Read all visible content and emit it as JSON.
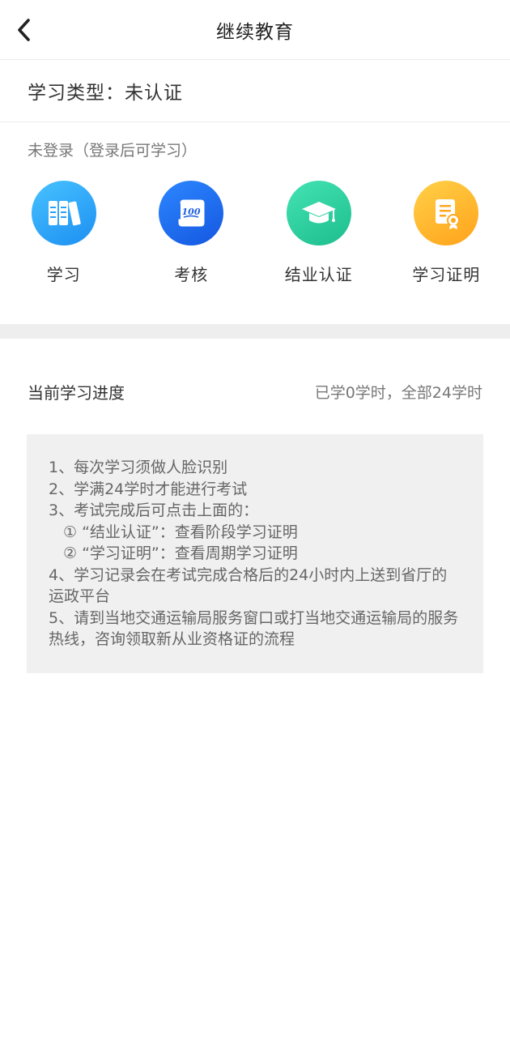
{
  "header": {
    "title": "继续教育",
    "back_icon": "chevron-left-icon"
  },
  "study_type": {
    "text": "学习类型：未认证"
  },
  "login_hint": "未登录（登录后可学习）",
  "features": [
    {
      "label": "学习",
      "icon": "books-icon",
      "color": "#2aa6f8"
    },
    {
      "label": "考核",
      "icon": "exam-scroll-icon",
      "color": "#1f6ef0"
    },
    {
      "label": "结业认证",
      "icon": "graduation-cap-icon",
      "color": "#2dd3a2"
    },
    {
      "label": "学习证明",
      "icon": "certificate-icon",
      "color": "#ffb82e"
    }
  ],
  "progress": {
    "label": "当前学习进度",
    "value": "已学0学时，全部24学时"
  },
  "notice": {
    "lines": [
      "1、每次学习须做人脸识别",
      "2、学满24学时才能进行考试",
      "3、考试完成后可点击上面的：",
      "① “结业认证”：查看阶段学习证明",
      "② “学习证明”：查看周期学习证明",
      "4、学习记录会在考试完成合格后的24小时内上送到省厅的运政平台",
      "5、请到当地交通运输局服务窗口或打当地交通运输局的服务热线，咨询领取新从业资格证的流程"
    ]
  }
}
